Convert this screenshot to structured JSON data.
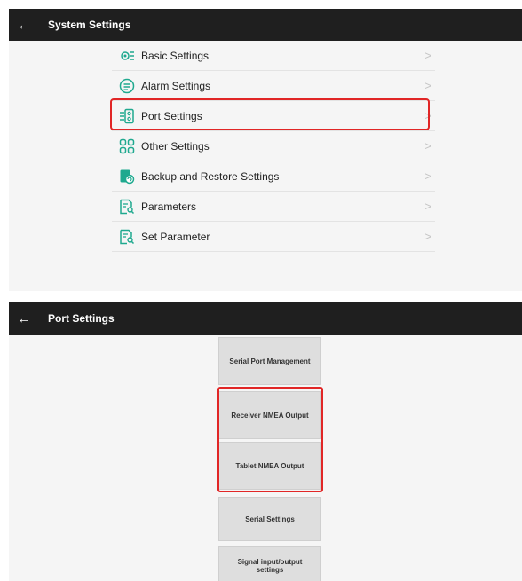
{
  "screen1": {
    "title": "System Settings",
    "items": [
      {
        "label": "Basic Settings",
        "icon": "gear-sliders-icon"
      },
      {
        "label": "Alarm Settings",
        "icon": "alarm-list-icon"
      },
      {
        "label": "Port Settings",
        "icon": "port-icon"
      },
      {
        "label": "Other Settings",
        "icon": "grid-icon"
      },
      {
        "label": "Backup and Restore Settings",
        "icon": "backup-restore-icon"
      },
      {
        "label": "Parameters",
        "icon": "document-search-icon"
      },
      {
        "label": "Set Parameter",
        "icon": "document-search-icon"
      }
    ],
    "chevron": ">"
  },
  "screen2": {
    "title": "Port Settings",
    "buttons": [
      {
        "label": "Serial Port Management"
      },
      {
        "label": "Receiver NMEA Output"
      },
      {
        "label": "Tablet NMEA Output"
      },
      {
        "label": "Serial Settings"
      },
      {
        "label": "Signal input/output settings"
      }
    ]
  },
  "colors": {
    "topbar": "#1f1f1f",
    "icon_teal": "#1fa98f",
    "highlight": "#e12626",
    "button_bg": "#dedede"
  },
  "back_glyph": "←"
}
